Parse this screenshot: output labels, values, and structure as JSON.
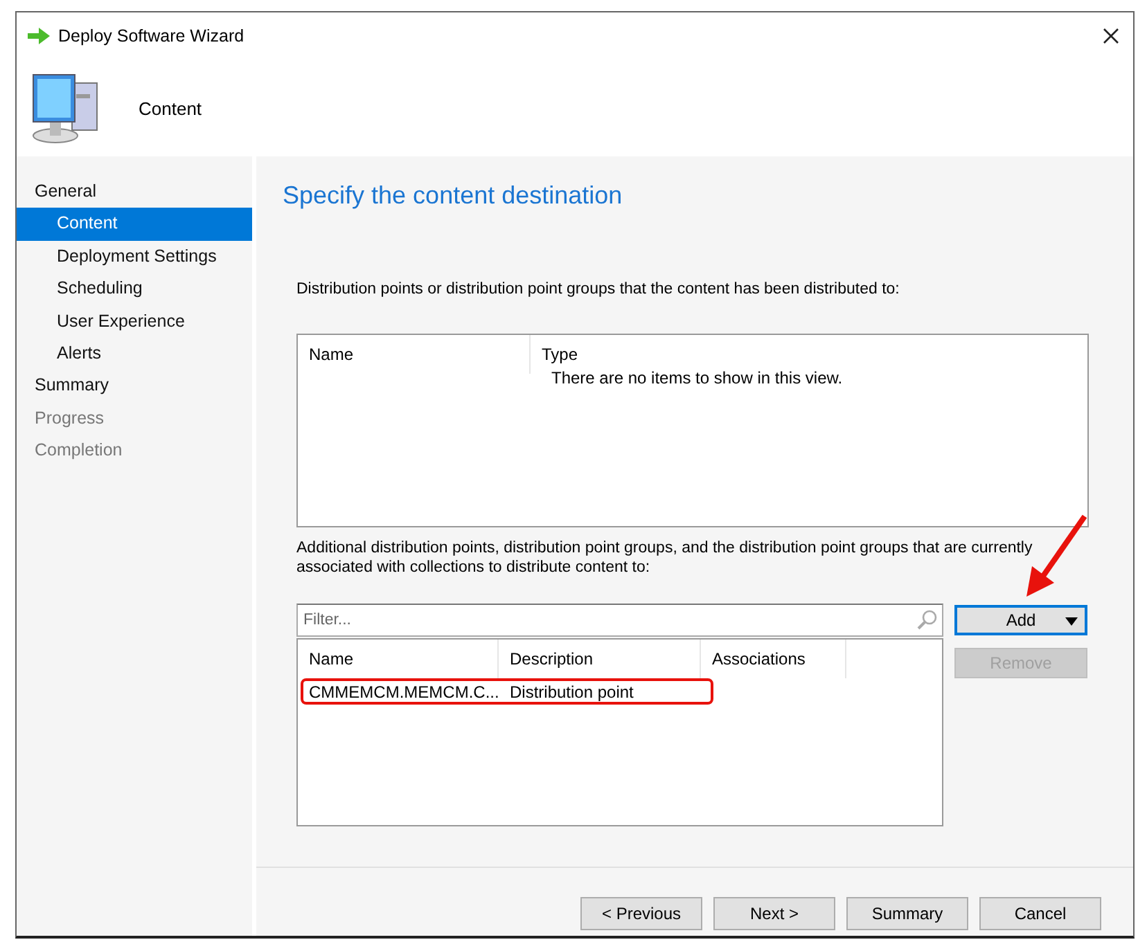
{
  "window": {
    "title": "Deploy Software Wizard"
  },
  "header": {
    "title": "Content"
  },
  "sidebar": {
    "items": [
      {
        "label": "General",
        "selected": false,
        "disabled": false,
        "children": [
          {
            "label": "Content",
            "selected": true,
            "disabled": false
          },
          {
            "label": "Deployment Settings",
            "selected": false,
            "disabled": false
          },
          {
            "label": "Scheduling",
            "selected": false,
            "disabled": false
          },
          {
            "label": "User Experience",
            "selected": false,
            "disabled": false
          },
          {
            "label": "Alerts",
            "selected": false,
            "disabled": false
          }
        ]
      },
      {
        "label": "Summary",
        "selected": false,
        "disabled": false
      },
      {
        "label": "Progress",
        "selected": false,
        "disabled": true
      },
      {
        "label": "Completion",
        "selected": false,
        "disabled": true
      }
    ]
  },
  "page_title": "Specify the content destination",
  "distributed": {
    "label": "Distribution points or distribution point groups that the content has been distributed to:",
    "columns": [
      "Name",
      "Type"
    ],
    "empty_text": "There are no items to show in this view."
  },
  "additional": {
    "label": "Additional distribution points, distribution point groups, and the distribution point groups that are currently associated with collections to distribute content to:",
    "filter": {
      "placeholder": "Filter..."
    },
    "columns": [
      "Name",
      "Description",
      "Associations"
    ],
    "rows": [
      {
        "cells": [
          "CMMEMCM.MEMCM.C...",
          "Distribution point"
        ],
        "highlighted": true
      }
    ]
  },
  "side_buttons": [
    {
      "label": "Add",
      "kind": "dropdown",
      "disabled": false,
      "focused": true
    },
    {
      "label": "Remove",
      "kind": "plain",
      "disabled": true,
      "focused": false
    }
  ],
  "footer_buttons": [
    "< Previous",
    "Next >",
    "Summary",
    "Cancel"
  ]
}
